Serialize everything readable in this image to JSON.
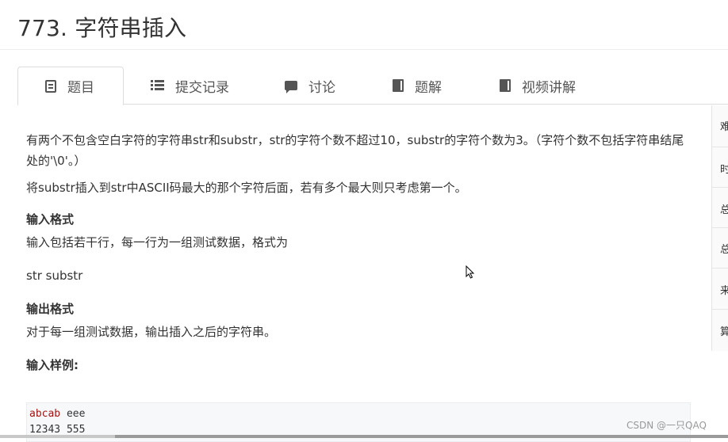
{
  "page": {
    "title": "773. 字符串插入"
  },
  "tabs": [
    {
      "label": "题目",
      "icon": "document-icon",
      "active": true
    },
    {
      "label": "提交记录",
      "icon": "list-icon",
      "active": false
    },
    {
      "label": "讨论",
      "icon": "chat-icon",
      "active": false
    },
    {
      "label": "题解",
      "icon": "book-icon",
      "active": false
    },
    {
      "label": "视频讲解",
      "icon": "book-icon",
      "active": false
    }
  ],
  "problem": {
    "description_1": "有两个不包含空白字符的字符串str和substr，str的字符个数不超过10，substr的字符个数为3。（字符个数不包括字符串结尾处的'\\0'。）",
    "description_2": "将substr插入到str中ASCII码最大的那个字符后面，若有多个最大则只考虑第一个。",
    "input_heading": "输入格式",
    "input_text": "输入包括若干行，每一行为一组测试数据，格式为",
    "input_format": "str substr",
    "output_heading": "输出格式",
    "output_text": "对于每一组测试数据，输出插入之后的字符串。",
    "sample_heading": "输入样例:",
    "sample_lines": [
      {
        "a": "abcab",
        "b": " eee"
      },
      {
        "a": "12343",
        "b": " 555"
      }
    ]
  },
  "right_panel": [
    "难",
    "时",
    "总",
    "总",
    "来",
    "算"
  ],
  "watermark": "CSDN @一只QAQ",
  "colors": {
    "text": "#333333",
    "code_keyword": "#a31515",
    "code_bg": "#f6f8fa"
  }
}
